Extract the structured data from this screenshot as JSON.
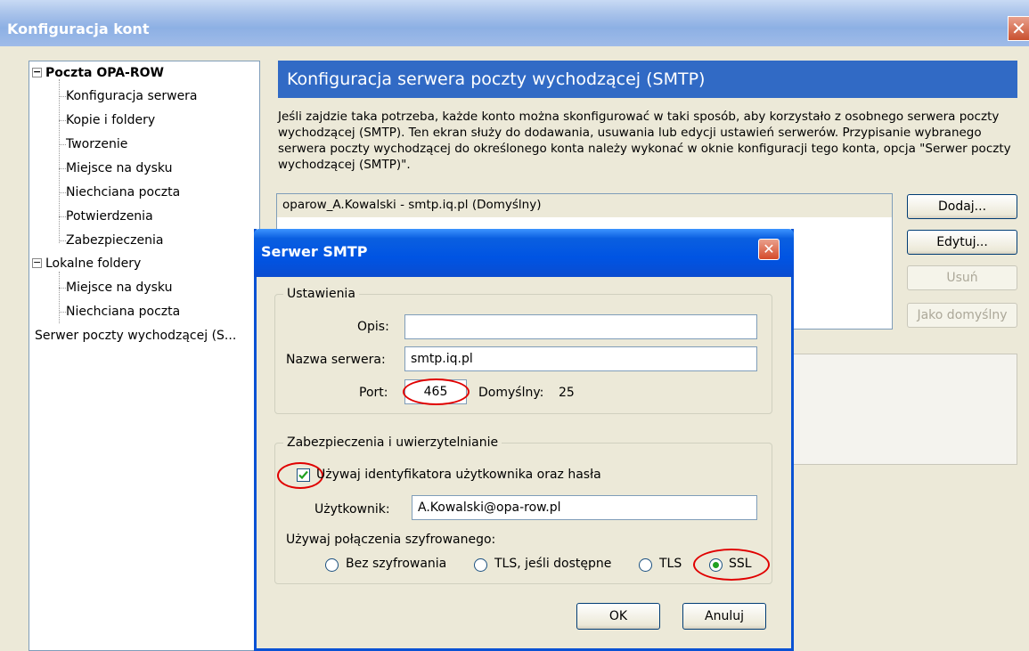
{
  "window": {
    "title": "Konfiguracja kont",
    "close_glyph": "✕"
  },
  "tree": {
    "items": [
      {
        "label": "Poczta OPA-ROW",
        "level": 0,
        "expander": "−"
      },
      {
        "label": "Konfiguracja serwera",
        "level": 1
      },
      {
        "label": "Kopie i foldery",
        "level": 1
      },
      {
        "label": "Tworzenie",
        "level": 1
      },
      {
        "label": "Miejsce na dysku",
        "level": 1
      },
      {
        "label": "Niechciana poczta",
        "level": 1
      },
      {
        "label": "Potwierdzenia",
        "level": 1
      },
      {
        "label": "Zabezpieczenia",
        "level": 1
      },
      {
        "label": "Lokalne foldery",
        "level": 0,
        "expander": "−"
      },
      {
        "label": "Miejsce na dysku",
        "level": 1
      },
      {
        "label": "Niechciana poczta",
        "level": 1
      },
      {
        "label": "Serwer poczty wychodzącej (S...",
        "level": 0
      }
    ]
  },
  "panel": {
    "heading": "Konfiguracja serwera poczty wychodzącej (SMTP)",
    "description": "Jeśli zajdzie taka potrzeba, każde konto można skonfigurować w taki sposób, aby korzystało z osobnego serwera poczty wychodzącej (SMTP). Ten ekran służy do dodawania, usuwania lub edycji ustawień serwerów. Przypisanie wybranego serwera poczty wychodzącej do określonego konta należy wykonać w oknie konfiguracji tego konta, opcja \"Serwer poczty wychodzącej (SMTP)\".",
    "servers": [
      "oparow_A.Kowalski - smtp.iq.pl (Domyślny)"
    ],
    "buttons": {
      "add": "Dodaj...",
      "edit": "Edytuj...",
      "remove": "Usuń",
      "set_default": "Jako domyślny"
    }
  },
  "dialog": {
    "title": "Serwer SMTP",
    "close_glyph": "✕",
    "settings_group": "Ustawienia",
    "description_label": "Opis:",
    "description_value": "",
    "server_label": "Nazwa serwera:",
    "server_value": "smtp.iq.pl",
    "port_label": "Port:",
    "port_value": "465",
    "default_label": "Domyślny:",
    "default_value": "25",
    "security_group": "Zabezpieczenia i uwierzytelnianie",
    "use_auth_label": "Używaj identyfikatora użytkownika oraz hasła",
    "use_auth_checked": true,
    "user_label": "Użytkownik:",
    "user_value": "A.Kowalski@opa-row.pl",
    "encryption_label": "Używaj połączenia szyfrowanego:",
    "encryption_options": [
      "Bez szyfrowania",
      "TLS, jeśli dostępne",
      "TLS",
      "SSL"
    ],
    "encryption_selected": "SSL",
    "ok_label": "OK",
    "cancel_label": "Anuluj",
    "highlight_color": "#e00000",
    "checkmark_color": "#21a121"
  }
}
